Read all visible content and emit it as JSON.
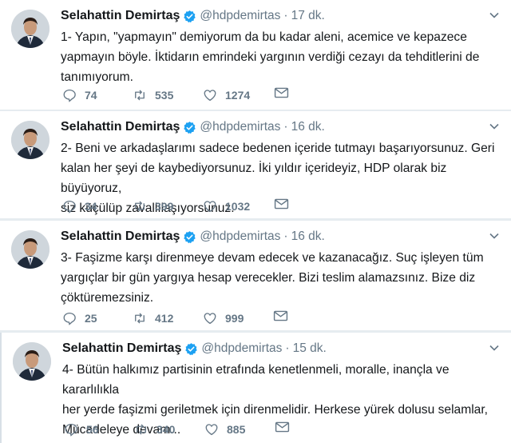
{
  "tweets": [
    {
      "name": "Selahattin Demirtaş",
      "handle": "@hdpdemirtas",
      "separator": "·",
      "time": "17 dk.",
      "text": "1- Yapın, \"yapmayın\" demiyorum da bu kadar aleni, acemice ve kepazece\nyapmayın böyle. İktidarın emrindeki yargının verdiği cezayı da tehditlerini de\ntanımıyorum.",
      "replies": "74",
      "retweets": "535",
      "likes": "1274"
    },
    {
      "name": "Selahattin Demirtaş",
      "handle": "@hdpdemirtas",
      "separator": "·",
      "time": "16 dk.",
      "text": "2- Beni ve arkadaşlarımı sadece bedenen içeride tutmayı başarıyorsunuz. Geri\nkalan her şeyi de kaybediyorsunuz. İki yıldır içerideyiz, HDP olarak biz büyüyoruz,\nsiz küçülüp zavallılaşıyorsunuz.",
      "replies": "34",
      "retweets": "399",
      "likes": "1032"
    },
    {
      "name": "Selahattin Demirtaş",
      "handle": "@hdpdemirtas",
      "separator": "·",
      "time": "16 dk.",
      "text": "3- Faşizme karşı direnmeye devam edecek ve kazanacağız. Suç işleyen tüm\nyargıçlar bir gün yargıya hesap verecekler. Bizi teslim alamazsınız. Bize diz\nçöktüremezsiniz.",
      "replies": "25",
      "retweets": "412",
      "likes": "999"
    },
    {
      "name": "Selahattin Demirtaş",
      "handle": "@hdpdemirtas",
      "separator": "·",
      "time": "15 dk.",
      "text": "4- Bütün halkımız partisinin etrafında kenetlenmeli, moralle, inançla ve kararlılıkla\nher yerde faşizmi geriletmek için direnmelidir. Herkese yürek dolusu selamlar,\nMücadeleye devam...",
      "replies": "56",
      "retweets": "340",
      "likes": "885"
    }
  ],
  "colors": {
    "text": "#14171a",
    "secondary": "#657786",
    "verified": "#1da1f2",
    "separator": "#e6ecf0"
  },
  "icons": [
    "avatar",
    "verified-badge-icon",
    "chevron-down-icon",
    "reply-icon",
    "retweet-icon",
    "like-icon",
    "direct-message-icon"
  ]
}
